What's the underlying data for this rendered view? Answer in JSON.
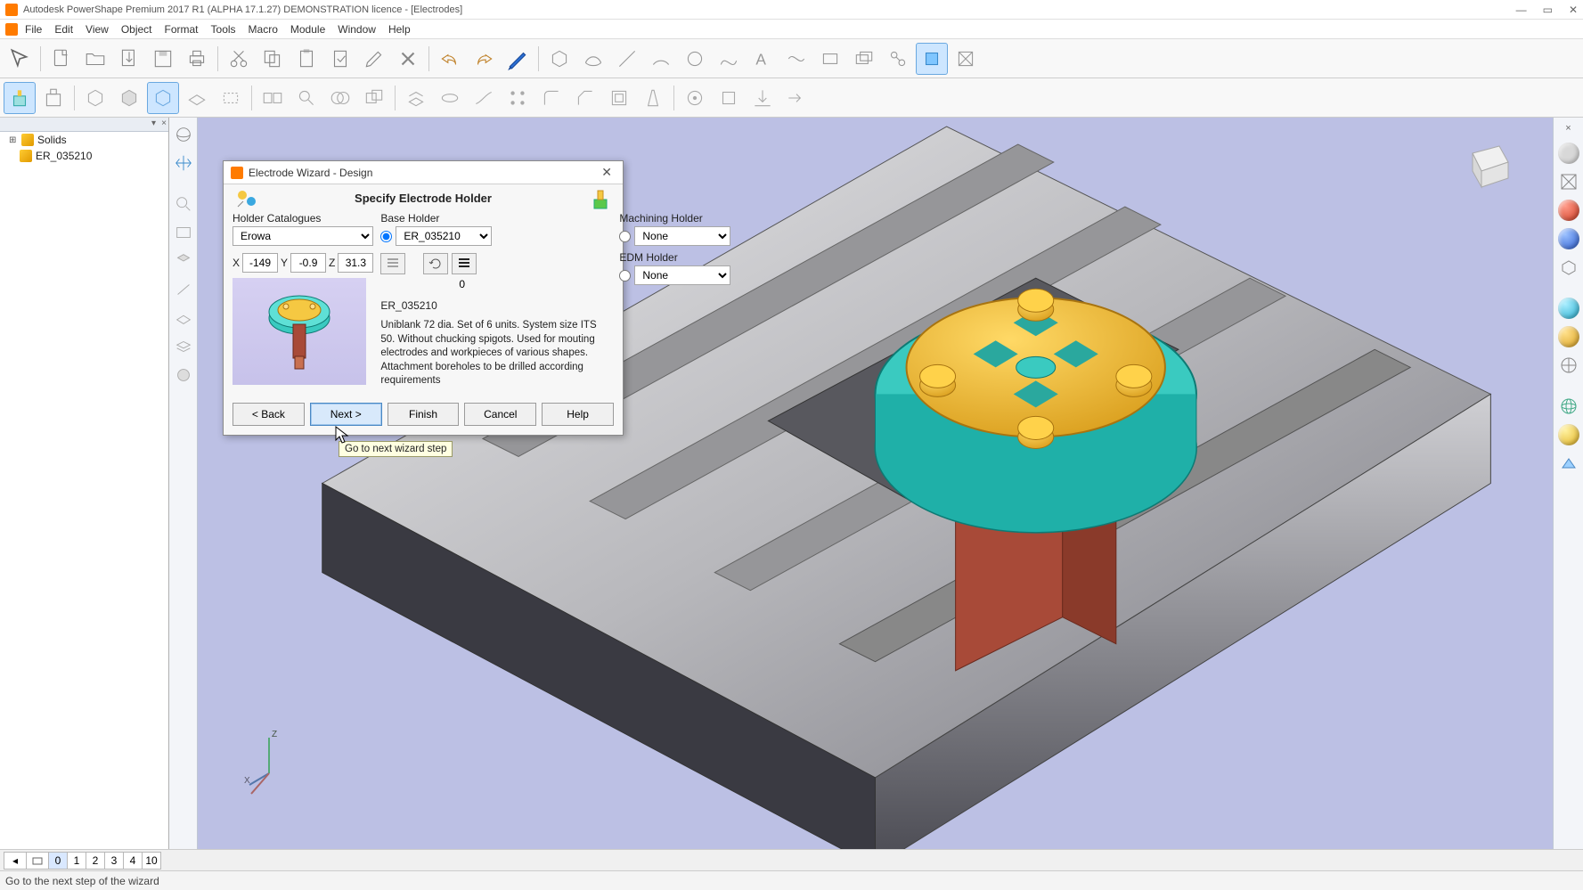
{
  "title": "Autodesk PowerShape Premium 2017 R1 (ALPHA 17.1.27) DEMONSTRATION licence - [Electrodes]",
  "menu": {
    "file": "File",
    "edit": "Edit",
    "view": "View",
    "object": "Object",
    "format": "Format",
    "tools": "Tools",
    "macro": "Macro",
    "module": "Module",
    "window": "Window",
    "help": "Help"
  },
  "tree": {
    "solids": "Solids",
    "item": "ER_035210"
  },
  "levels": {
    "i0": "0",
    "i1": "1",
    "i2": "2",
    "i3": "3",
    "i4": "4",
    "i10": "10"
  },
  "status": "Go to the next step of the wizard",
  "dialog": {
    "title": "Electrode Wizard - Design",
    "heading": "Specify Electrode Holder",
    "holderCatalogues": "Holder Catalogues",
    "holderCataloguesValue": "Erowa",
    "baseHolder": "Base Holder",
    "baseHolderValue": "ER_035210",
    "machiningHolder": "Machining Holder",
    "machiningHolderValue": "None",
    "edmHolder": "EDM Holder",
    "edmHolderValue": "None",
    "xLabel": "X",
    "xVal": "-149",
    "yLabel": "Y",
    "yVal": "-0.9",
    "zLabel": "Z",
    "zVal": "31.3",
    "zeroBelow": "0",
    "descCode": "ER_035210",
    "descText": "Uniblank 72 dia. Set of 6 units. System size ITS 50. Without chucking spigots. Used for mouting electrodes and workpieces of various shapes. Attachment boreholes to be drilled according requirements",
    "back": "< Back",
    "next": "Next >",
    "finish": "Finish",
    "cancel": "Cancel",
    "help": "Help",
    "tooltip": "Go to next wizard step"
  }
}
